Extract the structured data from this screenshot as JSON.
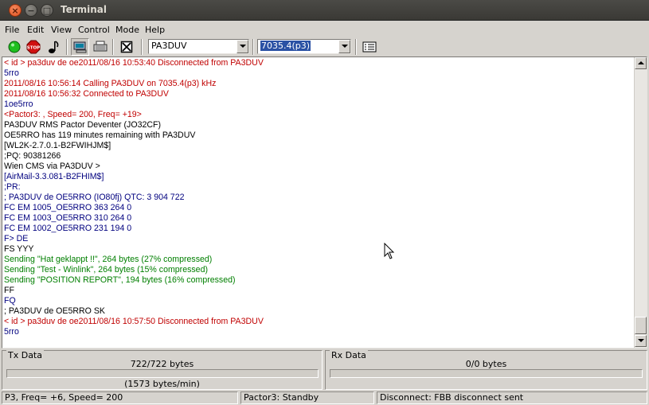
{
  "window": {
    "title": "Terminal"
  },
  "menu": [
    "File",
    "Edit",
    "View",
    "Control",
    "Mode",
    "Help"
  ],
  "toolbar": {
    "callsign": "PA3DUV",
    "frequency": "7035.4(p3)"
  },
  "colors": {
    "red": "#c00000",
    "blue": "#00007f",
    "green": "#007f00",
    "black": "#000000"
  },
  "terminal_lines": [
    {
      "text": "< id > pa3duv de oe2011/08/16 10:53:40 Disconnected from PA3DUV",
      "color": "red"
    },
    {
      "text": "5rro",
      "color": "blue"
    },
    {
      "text": "2011/08/16 10:56:14 Calling PA3DUV on 7035.4(p3) kHz",
      "color": "red"
    },
    {
      "text": "2011/08/16 10:56:32 Connected to PA3DUV",
      "color": "red"
    },
    {
      "text": "1oe5rro",
      "color": "blue"
    },
    {
      "text": "<Pactor3: , Speed= 200, Freq= +19>",
      "color": "red"
    },
    {
      "text": "PA3DUV RMS Pactor Deventer (JO32CF)",
      "color": "black"
    },
    {
      "text": "OE5RRO has 119 minutes remaining with PA3DUV",
      "color": "black"
    },
    {
      "text": "[WL2K-2.7.0.1-B2FWIHJM$]",
      "color": "black"
    },
    {
      "text": ";PQ: 90381266",
      "color": "black"
    },
    {
      "text": "Wien CMS via PA3DUV >",
      "color": "black"
    },
    {
      "text": "[AirMail-3.3.081-B2FHIM$]",
      "color": "blue"
    },
    {
      "text": ";PR:",
      "color": "blue"
    },
    {
      "text": "; PA3DUV de OE5RRO (IO80fj) QTC: 3 904 722",
      "color": "blue"
    },
    {
      "text": "FC EM 1005_OE5RRO 363 264 0",
      "color": "blue"
    },
    {
      "text": "FC EM 1003_OE5RRO 310 264 0",
      "color": "blue"
    },
    {
      "text": "FC EM 1002_OE5RRO 231 194 0",
      "color": "blue"
    },
    {
      "text": "F> DE",
      "color": "blue"
    },
    {
      "text": "FS YYY",
      "color": "black"
    },
    {
      "text": "Sending \"Hat geklappt !!\", 264 bytes (27% compressed)",
      "color": "green"
    },
    {
      "text": "Sending \"Test - Winlink\", 264 bytes (15% compressed)",
      "color": "green"
    },
    {
      "text": "Sending \"POSITION REPORT\", 194 bytes (16% compressed)",
      "color": "green"
    },
    {
      "text": "FF",
      "color": "black"
    },
    {
      "text": "FQ",
      "color": "blue"
    },
    {
      "text": "; PA3DUV de OE5RRO SK",
      "color": "black"
    },
    {
      "text": "< id > pa3duv de oe2011/08/16 10:57:50 Disconnected from PA3DUV",
      "color": "red"
    },
    {
      "text": "5rro",
      "color": "blue"
    }
  ],
  "tx": {
    "label": "Tx Data",
    "bytes": "722/722 bytes",
    "rate": "(1573 bytes/min)"
  },
  "rx": {
    "label": "Rx Data",
    "bytes": "0/0 bytes"
  },
  "status": {
    "left": "P3, Freq= +6, Speed= 200",
    "middle": "Pactor3: Standby",
    "right": "Disconnect: FBB disconnect sent"
  }
}
